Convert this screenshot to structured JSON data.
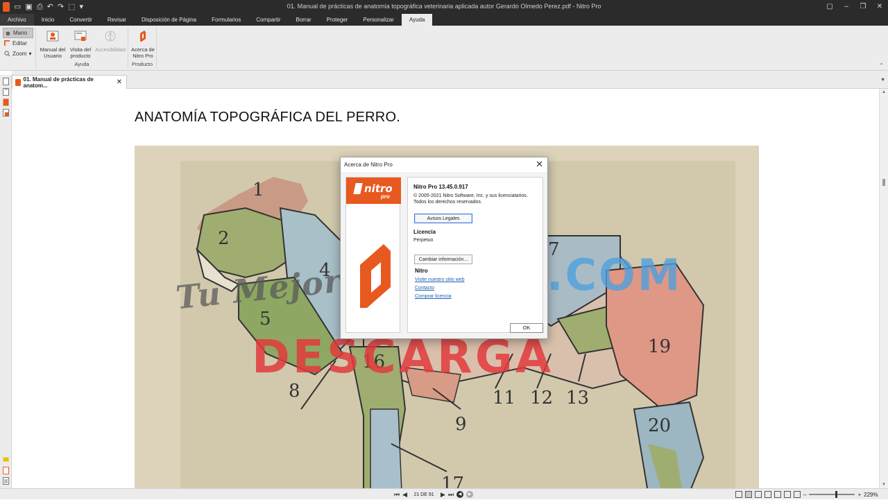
{
  "window": {
    "title": "01. Manual de prácticas de anatomía topográfica veterinaria aplicada autor Gerardo Olmedo Perez.pdf - Nitro Pro",
    "controls": [
      "chat-icon",
      "minimize-icon",
      "restore-icon",
      "close-icon"
    ]
  },
  "quick_access": [
    "nitro-logo-icon",
    "open-folder-icon",
    "save-icon",
    "print-icon",
    "undo-icon",
    "redo-icon",
    "select-icon"
  ],
  "menu": {
    "tabs": [
      "Archivo",
      "Inicio",
      "Convertir",
      "Revisar",
      "Disposición de Página",
      "Formularios",
      "Compartir",
      "Borrar",
      "Proteger",
      "Personalizar",
      "Ayuda"
    ],
    "active": "Ayuda"
  },
  "ribbon": {
    "tools": {
      "hand": "Mano",
      "edit": "Editar",
      "zoom": "Zoom"
    },
    "help_group": {
      "label": "Ayuda",
      "manual": "Manual del Usuario",
      "tour": "Visita del producto",
      "accessibility": "Accesibilidad"
    },
    "product_group": {
      "label": "Producto",
      "about": "Acerca de Nitro Pro"
    }
  },
  "doc_tab": {
    "label": "01. Manual de prácticas de anatom...",
    "close": "✕"
  },
  "document": {
    "heading": "ANATOMÍA TOPOGRÁFICA DEL PERRO.",
    "region_numbers": [
      "1",
      "2",
      "4",
      "5",
      "7",
      "8",
      "9",
      "11",
      "12",
      "13",
      "16",
      "17",
      "19",
      "20"
    ]
  },
  "watermark": {
    "line1": "Tu Mejor",
    "line2": "DESCARGA",
    "line3": ".COM"
  },
  "about_dialog": {
    "title": "Acerca de Nitro Pro",
    "badge_text": "nitro",
    "badge_sub": "pro",
    "version": "Nitro Pro 13.45.0.917",
    "copyright": "© 2005-2021 Nitro Software, Inc. y sus licenciatarios.",
    "rights": "Todos los derechos reservados.",
    "legal_button": "Avisos Legales",
    "license_heading": "Licencia",
    "license_value": "Perpetuo",
    "change_info_button": "Cambiar información...",
    "nitro_heading": "Nitro",
    "links": [
      "Visite nuestro sitio web",
      "Contacto",
      "Comprar licencia"
    ],
    "ok": "OK"
  },
  "status": {
    "page": "21 DE 91",
    "zoom": "229%"
  },
  "colors": {
    "accent": "#e8591f",
    "titlebar": "#2b2b2b",
    "ribbon": "#ececec"
  }
}
